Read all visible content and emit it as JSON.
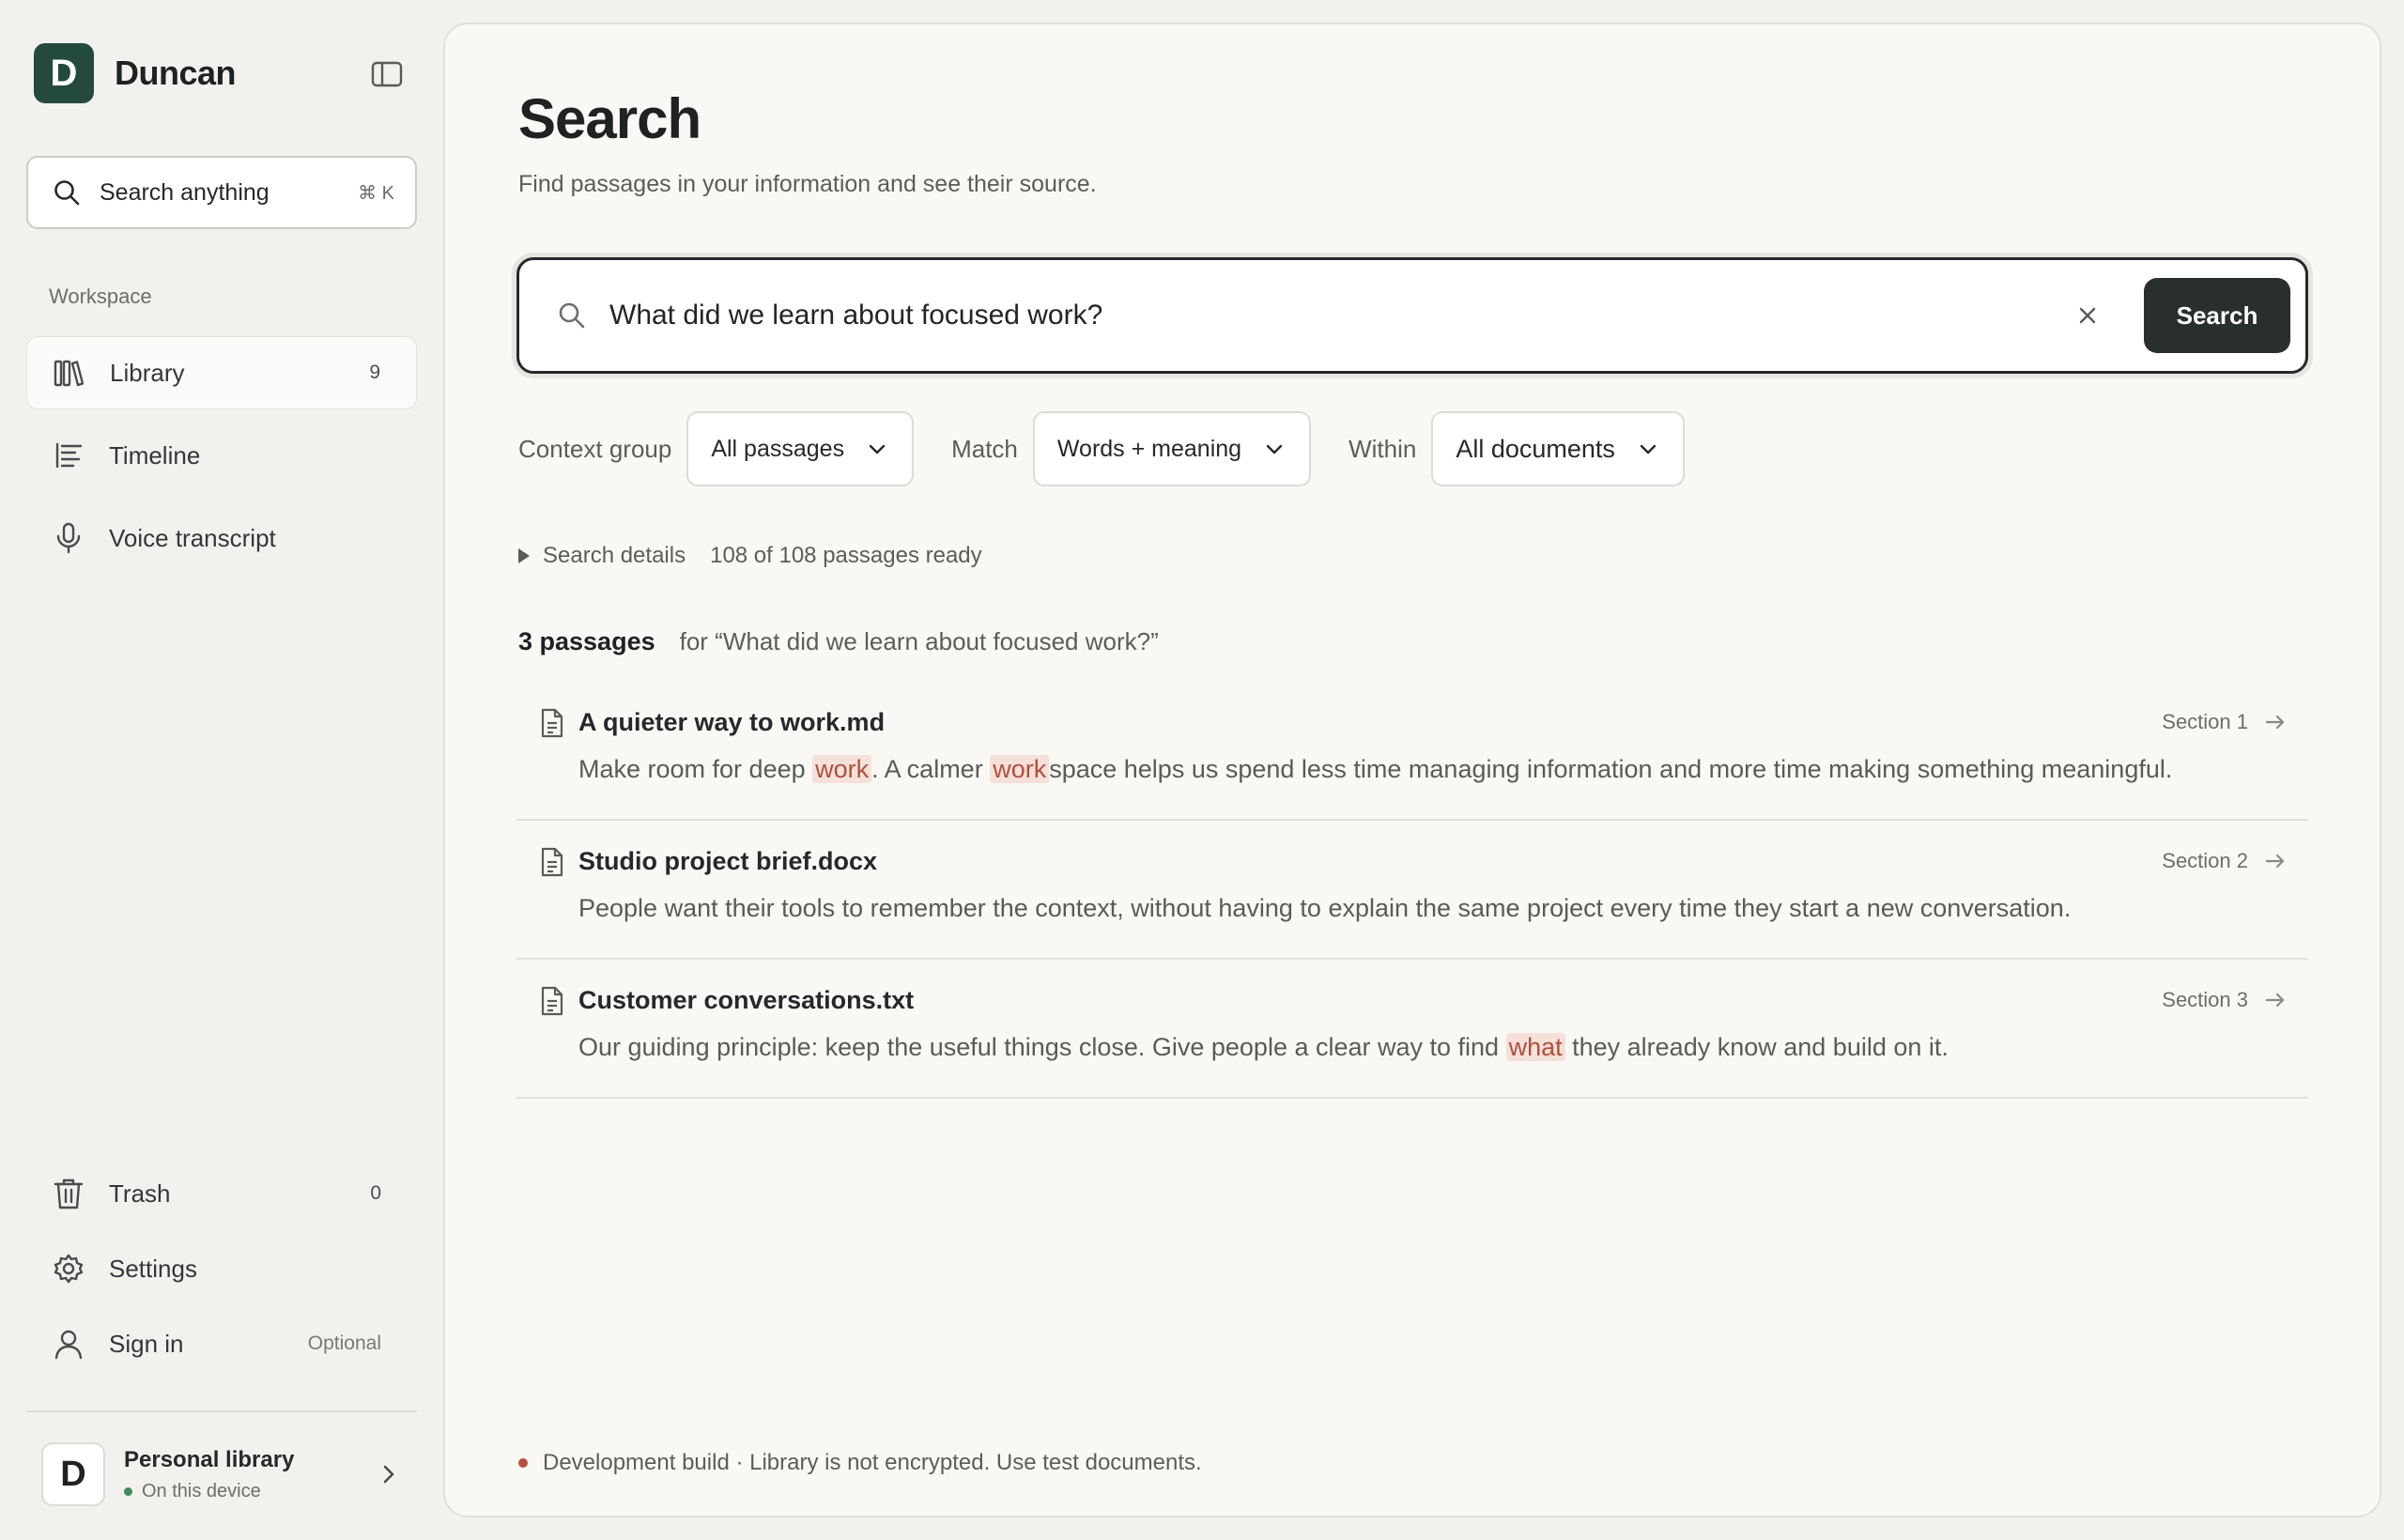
{
  "brand": {
    "logo_letter": "D",
    "name": "Duncan"
  },
  "sidebar": {
    "search": {
      "label": "Search anything",
      "shortcut": "⌘ K"
    },
    "section_label": "Workspace",
    "items": [
      {
        "label": "Library",
        "count": "9",
        "icon": "library-icon",
        "active": true
      },
      {
        "label": "Timeline",
        "icon": "timeline-icon"
      },
      {
        "label": "Voice transcript",
        "icon": "microphone-icon"
      }
    ],
    "bottom_items": [
      {
        "label": "Trash",
        "count": "0",
        "icon": "trash-icon"
      },
      {
        "label": "Settings",
        "icon": "gear-icon"
      },
      {
        "label": "Sign in",
        "note": "Optional",
        "icon": "user-icon"
      }
    ],
    "account": {
      "avatar_letter": "D",
      "name": "Personal library",
      "status": "On this device",
      "status_color": "#3f8a5b"
    }
  },
  "main": {
    "title": "Search",
    "subtitle": "Find passages in your information and see their source.",
    "query": "What did we learn about focused work?",
    "search_button": "Search",
    "filters": {
      "context_group": {
        "label": "Context group",
        "value": "All passages"
      },
      "match": {
        "label": "Match",
        "value": "Words + meaning"
      },
      "within": {
        "label": "Within",
        "value": "All documents"
      }
    },
    "details": {
      "label": "Search details",
      "status": "108 of 108 passages ready"
    },
    "results_summary": {
      "count": "3 passages",
      "query_echo": "for “What did we learn about focused work?”"
    },
    "results": [
      {
        "title": "A quieter way to work.md",
        "section": "Section 1",
        "snippet": {
          "t1": "Make room for deep ",
          "h1": "work",
          "t2": ". A calmer ",
          "h2": "work",
          "t3": "space helps us spend less time managing information and more time making something meaningful."
        }
      },
      {
        "title": "Studio project brief.docx",
        "section": "Section 2",
        "snippet": {
          "t1": "People want their tools to remember the context, without having to explain the same project every time they start a new conversation."
        }
      },
      {
        "title": "Customer conversations.txt",
        "section": "Section 3",
        "snippet": {
          "t1": "Our guiding principle: keep the useful things close. Give people a clear way to find ",
          "h1": "what",
          "t2": " they already know and build on it."
        }
      }
    ],
    "dev_note": "Development build · Library is not encrypted. Use test documents.",
    "dev_note_color": "#b5503b"
  },
  "colors": {
    "brand": "#244a3f",
    "button_dark": "#29302c",
    "highlight_bg": "#f5e0da",
    "highlight_text": "#b0503c"
  }
}
